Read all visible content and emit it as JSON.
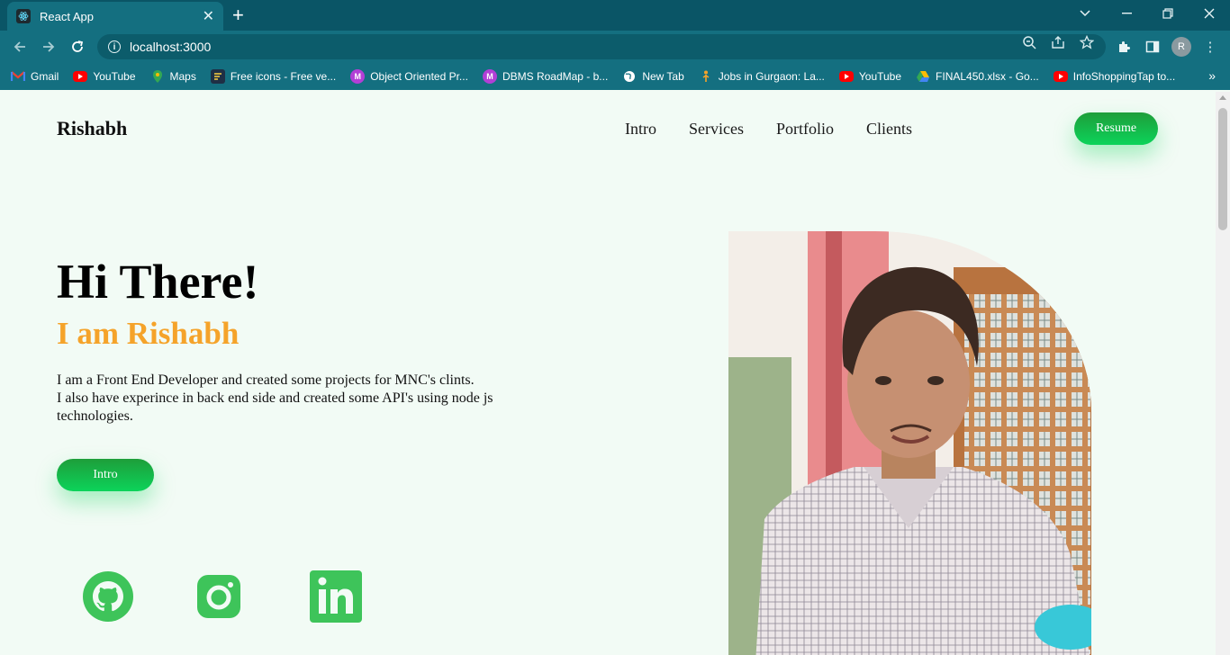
{
  "browser": {
    "tab_title": "React App",
    "url": "localhost:3000",
    "profile_initial": "R",
    "bookmarks": [
      {
        "label": "Gmail",
        "icon": "gmail-icon",
        "color": "#ea4335"
      },
      {
        "label": "YouTube",
        "icon": "youtube-icon",
        "color": "#ff0000"
      },
      {
        "label": "Maps",
        "icon": "maps-icon",
        "color": "#34a853"
      },
      {
        "label": "Free icons - Free ve...",
        "icon": "flaticon-icon",
        "color": "#1f3a5f"
      },
      {
        "label": "Object Oriented Pr...",
        "icon": "medium-icon",
        "color": "#b23fd6"
      },
      {
        "label": "DBMS RoadMap - b...",
        "icon": "medium-icon",
        "color": "#b23fd6"
      },
      {
        "label": "New Tab",
        "icon": "globe-icon",
        "color": "#ffffff"
      },
      {
        "label": "Jobs in Gurgaon: La...",
        "icon": "jobs-icon",
        "color": "#f5a32a"
      },
      {
        "label": "YouTube",
        "icon": "youtube-icon",
        "color": "#ff0000"
      },
      {
        "label": "FINAL450.xlsx - Go...",
        "icon": "drive-icon",
        "color": "#fbbc04"
      },
      {
        "label": "InfoShoppingTap to...",
        "icon": "youtube-icon",
        "color": "#ff0000"
      }
    ]
  },
  "site": {
    "brand": "Rishabh",
    "nav": [
      "Intro",
      "Services",
      "Portfolio",
      "Clients"
    ],
    "resume_label": "Resume",
    "hero": {
      "greeting": "Hi There!",
      "subtitle": "I am Rishabh",
      "desc_line1": "I am a Front End Developer and created some projects for MNC's clints.",
      "desc_line2": "I also have experince in back end side and created some API's using node js technologies.",
      "intro_label": "Intro"
    },
    "social": [
      "github-icon",
      "instagram-icon",
      "linkedin-icon"
    ],
    "colors": {
      "accent": "#f5a32a",
      "button": "#16b84a",
      "social": "#3ec45a",
      "background": "#f2fbf5"
    }
  }
}
